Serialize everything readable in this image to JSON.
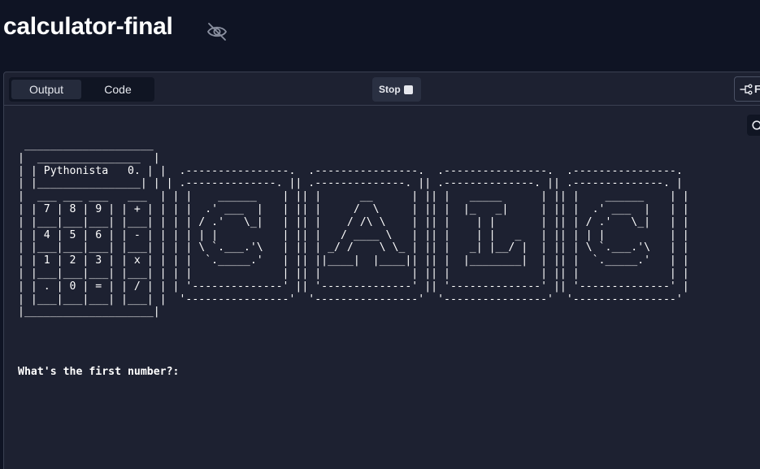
{
  "header": {
    "title": "calculator-final",
    "visibility_icon": "eye-off-icon"
  },
  "toolbar": {
    "tabs": [
      {
        "label": "Output",
        "active": true
      },
      {
        "label": "Code",
        "active": false
      }
    ],
    "stop_label": "Stop",
    "right_button_label": "F",
    "search_icon": "search-icon"
  },
  "console": {
    "ascii_art": " ____________________\n|  ________________  |\n| | Pythonista   0. | |  .----------------.  .----------------.  .----------------.  .----------------.\n| |________________| | | .--------------. || .--------------. || .--------------. || .--------------. |\n|  ___ ___ ___   ___  | | |    ______    | || |      __      | || |   _____      | || |    ______    | |\n| | 7 | 8 | 9 | | + | | | |  .' ___  |   | || |     /  \\     | || |  |_   _|     | || |  .' ___  |   | |\n| |___|___|___| |___| | | | / .'   \\_|   | || |    / /\\ \\    | || |    | |       | || | / .'   \\_|   | |\n| | 4 | 5 | 6 | | - | | | | | |          | || |   / ____ \\   | || |    | |   _   | || | | |          | |\n| |___|___|___| |___| | | | \\ `.___.'\\   | || | _/ /    \\ \\_ | || |   _| |__/ |  | || | \\ `.___.'\\   | |\n| | 1 | 2 | 3 | | x | | | |  `._____.'   | || ||____|  |____|| || |  |________|  | || |  `._____.'   | |\n| |___|___|___| |___| | | |              | || |              | || |              | || |              | |\n| | . | 0 | = | | / | | | '--------------' || '--------------' || '--------------' || '--------------' |\n| |___|___|___| |___| |  '----------------'  '----------------'  '----------------'  '----------------'\n|____________________|",
    "prompt": "What's the first number?:"
  },
  "colors": {
    "background": "#0f1424",
    "panel": "#1d2131",
    "text": "#ffffff"
  }
}
